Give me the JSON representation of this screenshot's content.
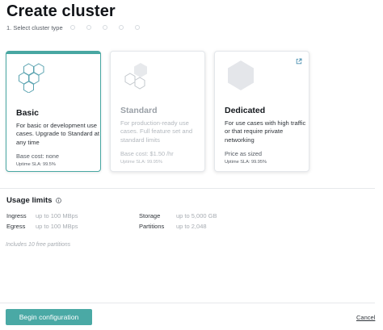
{
  "page": {
    "title": "Create cluster"
  },
  "stepper": {
    "label": "1. Select cluster type",
    "dots": 5
  },
  "cards": [
    {
      "title": "Basic",
      "description": "For basic or development use cases. Upgrade to Standard at any time",
      "cost": "Base cost: none",
      "sla": "Uptime SLA: 99.5%",
      "state": "selected"
    },
    {
      "title": "Standard",
      "description": "For production-ready use cases. Full feature set and standard limits",
      "cost": "Base cost: $1.50 /hr",
      "sla": "Uptime SLA: 99.95%",
      "state": "disabled"
    },
    {
      "title": "Dedicated",
      "description": "For use cases with high traffic or that require private networking",
      "cost": "Price as sized",
      "sla": "Uptime SLA: 99.95%",
      "state": "default",
      "link_icon": "external-link-icon"
    }
  ],
  "usage": {
    "title": "Usage limits",
    "info_icon": "info-icon",
    "rows": [
      {
        "label": "Ingress",
        "value": "up to 100 MBps"
      },
      {
        "label": "Egress",
        "value": "up to 100 MBps"
      },
      {
        "label": "Storage",
        "value": "up to 5,000 GB"
      },
      {
        "label": "Partitions",
        "value": "up to 2,048"
      }
    ],
    "note": "Includes 10 free partitions"
  },
  "footer": {
    "primary_label": "Begin configuration",
    "cancel_label": "Cancel"
  },
  "colors": {
    "accent": "#4aa9a5",
    "selected_border": "#48a7a2",
    "muted_text": "#a7acb2"
  }
}
